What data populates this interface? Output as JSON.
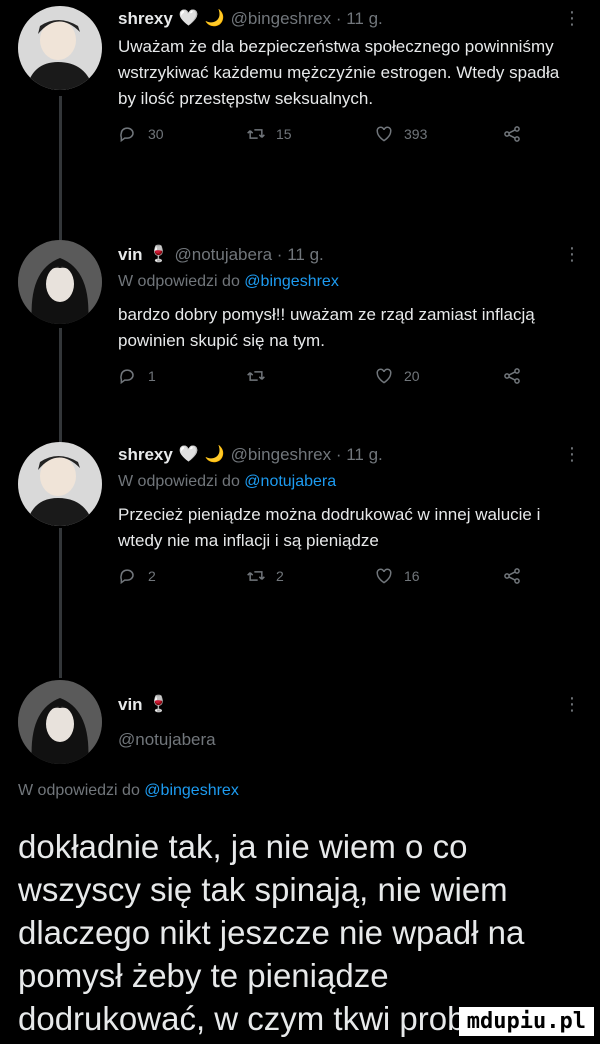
{
  "tweets": [
    {
      "name": "shrexy",
      "handle_time": "@bingeshrex · 11 g.",
      "text": "Uważam że dla bezpieczeństwa społecznego powinniśmy wstrzykiwać każdemu mężczyźnie estrogen. Wtedy spadła by ilość przestępstw seksualnych.",
      "replies": "30",
      "retweets": "15",
      "likes": "393"
    },
    {
      "name": "vin",
      "handle_time": "@notujabera · 11 g.",
      "reply_prefix": "W odpowiedzi do",
      "reply_handle": "@bingeshrex",
      "text": "bardzo dobry pomysł!! uważam ze rząd zamiast inflacją powinien skupić się na tym.",
      "replies": "1",
      "retweets": "",
      "likes": "20"
    },
    {
      "name": "shrexy",
      "handle_time": "@bingeshrex · 11 g.",
      "reply_prefix": "W odpowiedzi do",
      "reply_handle": "@notujabera",
      "text": "Przecież pieniądze można dodrukować w innej walucie i wtedy nie ma inflacji i są pieniądze",
      "replies": "2",
      "retweets": "2",
      "likes": "16"
    }
  ],
  "main": {
    "name": "vin",
    "handle": "@notujabera",
    "reply_prefix": "W odpowiedzi do",
    "reply_handle": "@bingeshrex",
    "text": "dokładnie tak, ja nie wiem o co wszyscy się tak spinają, nie wiem dlaczego nikt jeszcze nie wpadł na pomysł żeby te pieniądze dodrukować, w czym tkwi prob"
  },
  "watermark": "mdupiu.pl"
}
